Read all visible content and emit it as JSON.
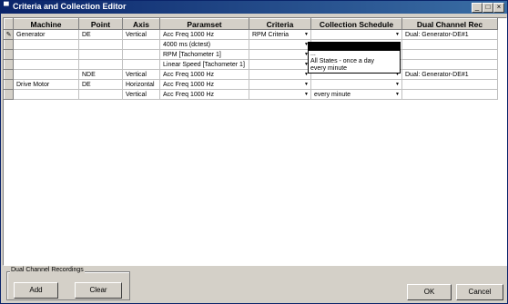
{
  "window": {
    "title": "Criteria and Collection Editor",
    "icon": "app-icon"
  },
  "title_buttons": {
    "minimize": "_",
    "maximize": "□",
    "close": "×"
  },
  "columns": [
    "Machine",
    "Point",
    "Axis",
    "Paramset",
    "Criteria",
    "Collection Schedule",
    "Dual Channel Rec"
  ],
  "rows": [
    {
      "indicator": "✎",
      "machine": "Generator",
      "point": "DE",
      "axis": "Vertical",
      "paramset": "Acc Freq 1000 Hz",
      "criteria": "RPM Criteria",
      "schedule": "",
      "dual": "Dual: Generator-DE#1"
    },
    {
      "indicator": "",
      "machine": "",
      "point": "",
      "axis": "",
      "paramset": "4000 ms (dctest)",
      "criteria": "",
      "schedule": "",
      "dual": ""
    },
    {
      "indicator": "",
      "machine": "",
      "point": "",
      "axis": "",
      "paramset": "RPM [Tachometer 1]",
      "criteria": "",
      "schedule": "",
      "dual": ""
    },
    {
      "indicator": "",
      "machine": "",
      "point": "",
      "axis": "",
      "paramset": "Linear Speed [Tachometer 1]",
      "criteria": "",
      "schedule": "",
      "dual": ""
    },
    {
      "indicator": "",
      "machine": "",
      "point": "NDE",
      "axis": "Vertical",
      "paramset": "Acc Freq 1000 Hz",
      "criteria": "",
      "schedule": "",
      "dual": "Dual: Generator-DE#1"
    },
    {
      "indicator": "",
      "machine": "Drive Motor",
      "point": "DE",
      "axis": "Horizontal",
      "paramset": "Acc Freq 1000 Hz",
      "criteria": "",
      "schedule": "",
      "dual": ""
    },
    {
      "indicator": "",
      "machine": "",
      "point": "",
      "axis": "Vertical",
      "paramset": "Acc Freq 1000 Hz",
      "criteria": "",
      "schedule": "every minute",
      "dual": ""
    }
  ],
  "schedule_dropdown": {
    "options": [
      "...",
      "All States - once a day",
      "every minute"
    ]
  },
  "group": {
    "label": "Dual Channel Recordings"
  },
  "buttons": {
    "add": "Add",
    "clear": "Clear",
    "ok": "OK",
    "cancel": "Cancel"
  }
}
